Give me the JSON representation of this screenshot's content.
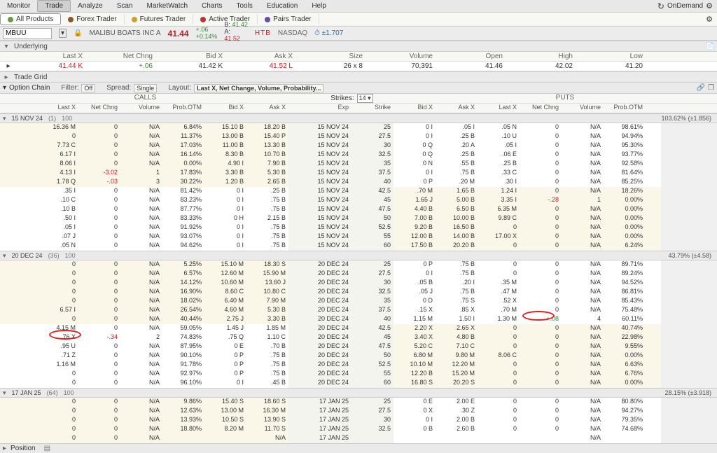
{
  "menu": {
    "items": [
      "Monitor",
      "Trade",
      "Analyze",
      "Scan",
      "MarketWatch",
      "Charts",
      "Tools",
      "Education",
      "Help"
    ],
    "active": 1,
    "ondemand": "OnDemand"
  },
  "product_tabs": {
    "items": [
      "All Products",
      "Forex Trader",
      "Futures Trader",
      "Active Trader",
      "Pairs Trader"
    ],
    "active": 0
  },
  "symbol": {
    "ticker": "MBUU",
    "name": "MALIBU BOATS INC A",
    "price": "41.44",
    "change": "+.06",
    "pct": "+0.14%",
    "bid_lbl": "B:",
    "bid": "41.42",
    "ask_lbl": "A:",
    "ask": "41.52",
    "htb": "HTB",
    "exchange": "NASDAQ",
    "range": "±1.707"
  },
  "sections": {
    "underlying": "Underlying",
    "trade_grid": "Trade Grid",
    "option_chain": "Option Chain",
    "position": "Position"
  },
  "underlying": {
    "cols": [
      "",
      "Last X",
      "Net Chng",
      "Bid X",
      "Ask X",
      "Size",
      "Volume",
      "Open",
      "High",
      "Low"
    ],
    "vals": [
      "▸",
      "41.44  K",
      "+.06",
      "41.42  K",
      "41.52  L",
      "26 x 8",
      "70,391",
      "41.46",
      "42.02",
      "41.20"
    ]
  },
  "filters": {
    "filter_lbl": "Filter:",
    "filter_val": "Off",
    "spread_lbl": "Spread:",
    "spread_val": "Single",
    "layout_lbl": "Layout:",
    "layout_val": "Last X, Net Change, Volume, Probability..."
  },
  "cp": {
    "calls": "CALLS",
    "puts": "PUTS",
    "strikes_lbl": "Strikes:",
    "strikes_val": "14"
  },
  "oc_cols": {
    "calls": [
      "",
      "Last X",
      "Net Chng",
      "Volume",
      "Prob.OTM",
      "Bid X",
      "Ask X"
    ],
    "mid": [
      "Exp",
      "Strike"
    ],
    "puts": [
      "Bid X",
      "Ask X",
      "Last X",
      "Net Chng",
      "Volume",
      "Prob.OTM",
      ""
    ]
  },
  "expiries": [
    {
      "label": "15 NOV 24",
      "dte": "(1)",
      "mult": "100",
      "summary": "103.62% (±1.856)",
      "rows": [
        {
          "c_itm": true,
          "p_itm": false,
          "c": [
            "16.36  M",
            "0",
            "N/A",
            "6.84%",
            "15.10  B",
            "18.20  B"
          ],
          "m": [
            "15 NOV 24",
            "25"
          ],
          "p": [
            "0  I",
            ".05  I",
            ".05  N",
            "0",
            "N/A",
            "98.61%"
          ]
        },
        {
          "c_itm": true,
          "p_itm": false,
          "c": [
            "0",
            "0",
            "N/A",
            "11.37%",
            "13.00  B",
            "15.40  P"
          ],
          "m": [
            "15 NOV 24",
            "27.5"
          ],
          "p": [
            "0  I",
            ".25  B",
            ".10  U",
            "0",
            "N/A",
            "94.94%"
          ]
        },
        {
          "c_itm": true,
          "p_itm": false,
          "c": [
            "7.73  C",
            "0",
            "N/A",
            "17.03%",
            "11.00  B",
            "13.30  B"
          ],
          "m": [
            "15 NOV 24",
            "30"
          ],
          "p": [
            "0  Q",
            ".20  A",
            ".05  I",
            "0",
            "N/A",
            "95.30%"
          ]
        },
        {
          "c_itm": true,
          "p_itm": false,
          "c": [
            "6.17  I",
            "0",
            "N/A",
            "16.14%",
            "8.30  B",
            "10.70  B"
          ],
          "m": [
            "15 NOV 24",
            "32.5"
          ],
          "p": [
            "0  Q",
            ".25  B",
            ".06  E",
            "0",
            "N/A",
            "93.77%"
          ]
        },
        {
          "c_itm": true,
          "p_itm": false,
          "c": [
            "8.06  I",
            "0",
            "N/A",
            "0.00%",
            "4.90  I",
            "7.90  B"
          ],
          "m": [
            "15 NOV 24",
            "35"
          ],
          "p": [
            "0  N",
            ".55  B",
            ".25  B",
            "0",
            "N/A",
            "92.58%"
          ]
        },
        {
          "c_itm": true,
          "p_itm": false,
          "c": [
            "4.13  I",
            "-3.02",
            "1",
            "17.83%",
            "3.30  B",
            "5.30  B"
          ],
          "m": [
            "15 NOV 24",
            "37.5"
          ],
          "p": [
            "0  I",
            ".75  B",
            ".33  C",
            "0",
            "N/A",
            "81.64%"
          ]
        },
        {
          "c_itm": true,
          "p_itm": false,
          "c": [
            "1.78  Q",
            "-.03",
            "3",
            "30.22%",
            "1.20  B",
            "2.65  B"
          ],
          "m": [
            "15 NOV 24",
            "40"
          ],
          "p": [
            "0  P",
            ".20  M",
            ".30  I",
            "0",
            "N/A",
            "85.25%"
          ]
        },
        {
          "c_itm": false,
          "p_itm": true,
          "c": [
            ".35  I",
            "0",
            "N/A",
            "81.42%",
            "0  I",
            ".25  B"
          ],
          "m": [
            "15 NOV 24",
            "42.5"
          ],
          "p": [
            ".70  M",
            "1.65  B",
            "1.24  I",
            "0",
            "N/A",
            "18.26%"
          ]
        },
        {
          "c_itm": false,
          "p_itm": true,
          "c": [
            ".10  C",
            "0",
            "N/A",
            "83.23%",
            "0  I",
            ".75  B"
          ],
          "m": [
            "15 NOV 24",
            "45"
          ],
          "p": [
            "1.65  J",
            "5.00  B",
            "3.35  I",
            "-.28",
            "1",
            "0.00%"
          ]
        },
        {
          "c_itm": false,
          "p_itm": true,
          "c": [
            ".10  B",
            "0",
            "N/A",
            "87.77%",
            "0  I",
            ".75  B"
          ],
          "m": [
            "15 NOV 24",
            "47.5"
          ],
          "p": [
            "4.40  B",
            "6.50  B",
            "6.35  M",
            "0",
            "N/A",
            "0.00%"
          ]
        },
        {
          "c_itm": false,
          "p_itm": true,
          "c": [
            ".50  I",
            "0",
            "N/A",
            "83.33%",
            "0  H",
            "2.15  B"
          ],
          "m": [
            "15 NOV 24",
            "50"
          ],
          "p": [
            "7.00  B",
            "10.00  B",
            "9.89  C",
            "0",
            "N/A",
            "0.00%"
          ]
        },
        {
          "c_itm": false,
          "p_itm": true,
          "c": [
            ".05  I",
            "0",
            "N/A",
            "91.92%",
            "0  I",
            ".75  B"
          ],
          "m": [
            "15 NOV 24",
            "52.5"
          ],
          "p": [
            "9.20  B",
            "16.50  B",
            "0",
            "0",
            "N/A",
            "0.00%"
          ]
        },
        {
          "c_itm": false,
          "p_itm": true,
          "c": [
            ".07  J",
            "0",
            "N/A",
            "93.07%",
            "0  I",
            ".75  B"
          ],
          "m": [
            "15 NOV 24",
            "55"
          ],
          "p": [
            "12.00  B",
            "14.00  B",
            "17.00  X",
            "0",
            "N/A",
            "0.00%"
          ]
        },
        {
          "c_itm": false,
          "p_itm": true,
          "c": [
            ".05  N",
            "0",
            "N/A",
            "94.62%",
            "0  I",
            ".75  B"
          ],
          "m": [
            "15 NOV 24",
            "60"
          ],
          "p": [
            "17.50  B",
            "20.20  B",
            "0",
            "0",
            "N/A",
            "6.24%"
          ]
        }
      ]
    },
    {
      "label": "20 DEC 24",
      "dte": "(36)",
      "mult": "100",
      "summary": "43.79% (±4.58)",
      "rows": [
        {
          "c_itm": true,
          "p_itm": false,
          "c": [
            "0",
            "0",
            "N/A",
            "5.25%",
            "15.10  M",
            "18.30  S"
          ],
          "m": [
            "20 DEC 24",
            "25"
          ],
          "p": [
            "0  P",
            ".75  B",
            "0",
            "0",
            "N/A",
            "89.71%"
          ]
        },
        {
          "c_itm": true,
          "p_itm": false,
          "c": [
            "0",
            "0",
            "N/A",
            "6.57%",
            "12.60  M",
            "15.90  M"
          ],
          "m": [
            "20 DEC 24",
            "27.5"
          ],
          "p": [
            "0  I",
            ".75  B",
            "0",
            "0",
            "N/A",
            "89.24%"
          ]
        },
        {
          "c_itm": true,
          "p_itm": false,
          "c": [
            "0",
            "0",
            "N/A",
            "14.12%",
            "10.60  M",
            "13.60  J"
          ],
          "m": [
            "20 DEC 24",
            "30"
          ],
          "p": [
            ".05  B",
            ".20  I",
            ".35  M",
            "0",
            "N/A",
            "94.52%"
          ]
        },
        {
          "c_itm": true,
          "p_itm": false,
          "c": [
            "0",
            "0",
            "N/A",
            "16.90%",
            "8.60  C",
            "10.80  C"
          ],
          "m": [
            "20 DEC 24",
            "32.5"
          ],
          "p": [
            ".05  J",
            ".75  B",
            ".47  M",
            "0",
            "N/A",
            "86.81%"
          ]
        },
        {
          "c_itm": true,
          "p_itm": false,
          "c": [
            "0",
            "0",
            "N/A",
            "18.02%",
            "6.40  M",
            "7.90  M"
          ],
          "m": [
            "20 DEC 24",
            "35"
          ],
          "p": [
            "0  D",
            ".75  S",
            ".52  X",
            "0",
            "N/A",
            "85.43%"
          ]
        },
        {
          "c_itm": true,
          "p_itm": false,
          "c": [
            "6.57  I",
            "0",
            "N/A",
            "26.54%",
            "4.60  M",
            "5.30  B"
          ],
          "m": [
            "20 DEC 24",
            "37.5"
          ],
          "p": [
            ".15  X",
            ".85  X",
            ".70  M",
            "0",
            "N/A",
            "75.48%"
          ]
        },
        {
          "c_itm": true,
          "p_itm": false,
          "c": [
            "0",
            "0",
            "N/A",
            "40.44%",
            "2.75  J",
            "3.30  B"
          ],
          "m": [
            "20 DEC 24",
            "40"
          ],
          "p": [
            "1.15  M",
            "1.50  I",
            "1.30  M",
            "+.08",
            "4",
            "60.11%"
          ]
        },
        {
          "c_itm": false,
          "p_itm": true,
          "c": [
            "4.15  M",
            "0",
            "N/A",
            "59.05%",
            "1.45  J",
            "1.85  M"
          ],
          "m": [
            "20 DEC 24",
            "42.5"
          ],
          "p": [
            "2.20  X",
            "2.65  X",
            "0",
            "0",
            "N/A",
            "40.74%"
          ]
        },
        {
          "c_itm": false,
          "p_itm": true,
          "c": [
            ".76  X",
            "-.34",
            "2",
            "74.83%",
            ".75  Q",
            "1.10  C"
          ],
          "m": [
            "20 DEC 24",
            "45"
          ],
          "p": [
            "3.40  X",
            "4.80  B",
            "0",
            "0",
            "N/A",
            "22.98%"
          ]
        },
        {
          "c_itm": false,
          "p_itm": true,
          "c": [
            ".95  U",
            "0",
            "N/A",
            "87.95%",
            "0  E",
            ".70  B"
          ],
          "m": [
            "20 DEC 24",
            "47.5"
          ],
          "p": [
            "5.20  C",
            "7.10  C",
            "0",
            "0",
            "N/A",
            "9.55%"
          ]
        },
        {
          "c_itm": false,
          "p_itm": true,
          "c": [
            ".71  Z",
            "0",
            "N/A",
            "90.10%",
            "0  P",
            ".75  B"
          ],
          "m": [
            "20 DEC 24",
            "50"
          ],
          "p": [
            "6.80  M",
            "9.80  M",
            "8.06  C",
            "0",
            "N/A",
            "0.00%"
          ]
        },
        {
          "c_itm": false,
          "p_itm": true,
          "c": [
            "1.16  M",
            "0",
            "N/A",
            "91.78%",
            "0  P",
            ".75  B"
          ],
          "m": [
            "20 DEC 24",
            "52.5"
          ],
          "p": [
            "10.10  M",
            "12.20  M",
            "0",
            "0",
            "N/A",
            "6.63%"
          ]
        },
        {
          "c_itm": false,
          "p_itm": true,
          "c": [
            "0",
            "0",
            "N/A",
            "92.97%",
            "0  P",
            ".75  B"
          ],
          "m": [
            "20 DEC 24",
            "55"
          ],
          "p": [
            "12.20  B",
            "15.20  M",
            "0",
            "0",
            "N/A",
            "6.76%"
          ]
        },
        {
          "c_itm": false,
          "p_itm": true,
          "c": [
            "0",
            "0",
            "N/A",
            "96.10%",
            "0  I",
            ".45  B"
          ],
          "m": [
            "20 DEC 24",
            "60"
          ],
          "p": [
            "16.80  S",
            "20.20  S",
            "0",
            "0",
            "N/A",
            "0.00%"
          ]
        }
      ]
    },
    {
      "label": "17 JAN 25",
      "dte": "(64)",
      "mult": "100",
      "summary": "28.15% (±3.918)",
      "partial": true,
      "rows": [
        {
          "c_itm": true,
          "p_itm": false,
          "c": [
            "0",
            "0",
            "N/A",
            "9.86%",
            "15.40  S",
            "18.60  S"
          ],
          "m": [
            "17 JAN 25",
            "25"
          ],
          "p": [
            "0  E",
            "2.00  E",
            "0",
            "0",
            "N/A",
            "80.80%"
          ]
        },
        {
          "c_itm": true,
          "p_itm": false,
          "c": [
            "0",
            "0",
            "N/A",
            "12.63%",
            "13.00  M",
            "16.30  M"
          ],
          "m": [
            "17 JAN 25",
            "27.5"
          ],
          "p": [
            "0  X",
            ".30  Z",
            "0",
            "0",
            "N/A",
            "94.27%"
          ]
        },
        {
          "c_itm": true,
          "p_itm": false,
          "c": [
            "0",
            "0",
            "N/A",
            "13.93%",
            "10.50  S",
            "13.90  S"
          ],
          "m": [
            "17 JAN 25",
            "30"
          ],
          "p": [
            "0  I",
            "2.00  B",
            "0",
            "0",
            "N/A",
            "79.35%"
          ]
        },
        {
          "c_itm": true,
          "p_itm": false,
          "c": [
            "0",
            "0",
            "N/A",
            "18.80%",
            "8.20  M",
            "11.70  S"
          ],
          "m": [
            "17 JAN 25",
            "32.5"
          ],
          "p": [
            "0  B",
            "2.60  B",
            "0",
            "0",
            "N/A",
            "74.68%"
          ]
        },
        {
          "c_itm": true,
          "p_itm": false,
          "c": [
            "0",
            "0",
            "N/A",
            "",
            "",
            "N/A"
          ],
          "m": [
            "17 JAN 25",
            ""
          ],
          "p": [
            "",
            "",
            "",
            "",
            "N/A",
            ""
          ]
        }
      ]
    }
  ]
}
